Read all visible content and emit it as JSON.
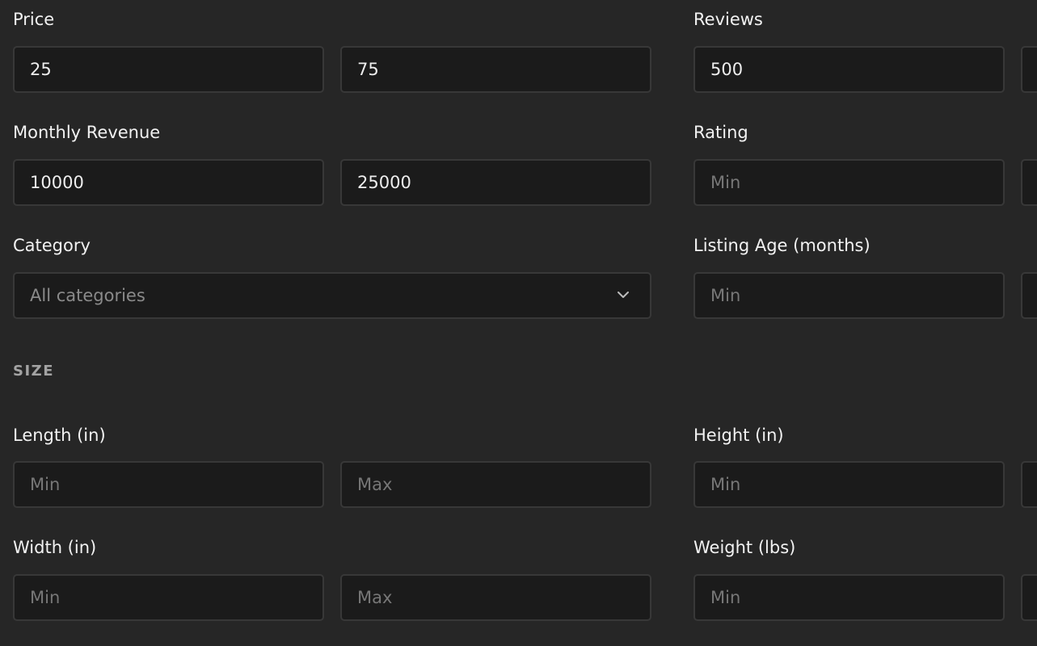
{
  "left": {
    "price": {
      "label": "Price",
      "min_value": "25",
      "max_value": "75"
    },
    "monthly_revenue": {
      "label": "Monthly Revenue",
      "min_value": "10000",
      "max_value": "25000"
    },
    "category": {
      "label": "Category",
      "selected": "All categories",
      "icon": "chevron-down-icon"
    },
    "size_section": {
      "title": "SIZE"
    },
    "length": {
      "label": "Length (in)",
      "min_placeholder": "Min",
      "max_placeholder": "Max"
    },
    "width": {
      "label": "Width (in)",
      "min_placeholder": "Min",
      "max_placeholder": "Max"
    }
  },
  "right": {
    "reviews": {
      "label": "Reviews",
      "min_value": "500"
    },
    "rating": {
      "label": "Rating",
      "min_placeholder": "Min"
    },
    "listing_age": {
      "label": "Listing Age (months)",
      "min_placeholder": "Min"
    },
    "height": {
      "label": "Height (in)",
      "min_placeholder": "Min"
    },
    "weight": {
      "label": "Weight (lbs)",
      "min_placeholder": "Min"
    }
  },
  "theme": {
    "background": "#262626",
    "field_background": "#1b1b1b",
    "field_border": "#383838",
    "text": "#f2f2f2",
    "placeholder": "#777777"
  }
}
